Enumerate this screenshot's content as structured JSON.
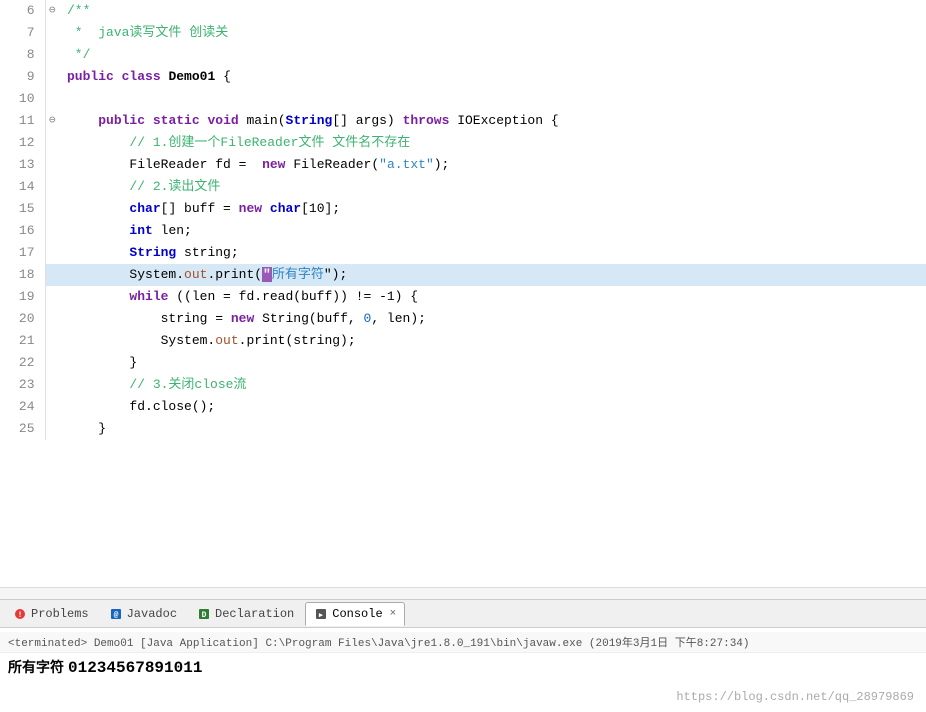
{
  "editor": {
    "lines": [
      {
        "num": "6",
        "marker": "⊖",
        "content": "/**",
        "highlight": false,
        "tokens": [
          {
            "text": "/**",
            "class": "comment"
          }
        ]
      },
      {
        "num": "7",
        "marker": "",
        "content": " * java读写文件 创读关",
        "highlight": false,
        "tokens": [
          {
            "text": " * ",
            "class": "comment"
          },
          {
            "text": "java读写文件 创读关",
            "class": "comment"
          }
        ]
      },
      {
        "num": "8",
        "marker": "",
        "content": " */",
        "highlight": false,
        "tokens": [
          {
            "text": " */",
            "class": "comment"
          }
        ]
      },
      {
        "num": "9",
        "marker": "",
        "content_raw": "public class Demo01 {",
        "highlight": false
      },
      {
        "num": "10",
        "marker": "",
        "content_raw": "",
        "highlight": false
      },
      {
        "num": "11",
        "marker": "⊖",
        "content_raw": "    public static void main(String[] args) throws IOException {",
        "highlight": false
      },
      {
        "num": "12",
        "marker": "",
        "content_raw": "        // 1.创建一个FileReader文件 文件名不存在",
        "highlight": false
      },
      {
        "num": "13",
        "marker": "",
        "content_raw": "        FileReader fd = new FileReader(\"a.txt\");",
        "highlight": false
      },
      {
        "num": "14",
        "marker": "",
        "content_raw": "        // 2.读出文件",
        "highlight": false
      },
      {
        "num": "15",
        "marker": "",
        "content_raw": "        char[] buff = new char[10];",
        "highlight": false
      },
      {
        "num": "16",
        "marker": "",
        "content_raw": "        int len;",
        "highlight": false
      },
      {
        "num": "17",
        "marker": "",
        "content_raw": "        String string;",
        "highlight": false
      },
      {
        "num": "18",
        "marker": "",
        "content_raw": "        System.out.print(\"所有字符\");",
        "highlight": true
      },
      {
        "num": "19",
        "marker": "",
        "content_raw": "        while ((len = fd.read(buff)) != -1) {",
        "highlight": false
      },
      {
        "num": "20",
        "marker": "",
        "content_raw": "            string = new String(buff, 0, len);",
        "highlight": false
      },
      {
        "num": "21",
        "marker": "",
        "content_raw": "            System.out.print(string);",
        "highlight": false
      },
      {
        "num": "22",
        "marker": "",
        "content_raw": "        }",
        "highlight": false
      },
      {
        "num": "23",
        "marker": "",
        "content_raw": "        // 3.关闭close流",
        "highlight": false
      },
      {
        "num": "24",
        "marker": "",
        "content_raw": "        fd.close();",
        "highlight": false
      },
      {
        "num": "25",
        "marker": "",
        "content_raw": "    }",
        "highlight": false
      }
    ]
  },
  "tabs": [
    {
      "id": "problems",
      "label": "Problems",
      "icon": "⚠",
      "active": false
    },
    {
      "id": "javadoc",
      "label": "Javadoc",
      "icon": "@",
      "active": false
    },
    {
      "id": "declaration",
      "label": "Declaration",
      "icon": "D",
      "active": false
    },
    {
      "id": "console",
      "label": "Console",
      "icon": "▶",
      "active": true,
      "close": "×"
    }
  ],
  "console": {
    "status": "<terminated> Demo01 [Java Application] C:\\Program Files\\Java\\jre1.8.0_191\\bin\\javaw.exe (2019年3月1日 下午8:27:34)",
    "output_label": "所有字符",
    "output_numbers": "01234567891011"
  },
  "watermark": "https://blog.csdn.net/qq_28979869"
}
